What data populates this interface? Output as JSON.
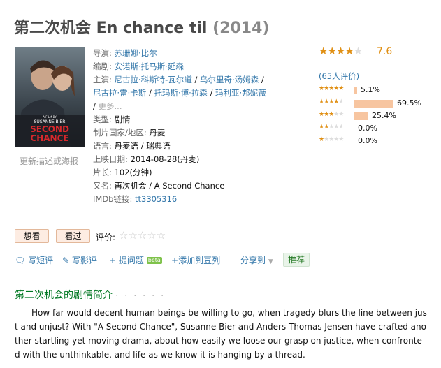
{
  "page": {
    "title_main": "第二次机会 En chance til",
    "title_year": "(2014)"
  },
  "poster": {
    "film_by": "A FILM BY",
    "director_caps": "SUSANNE BIER",
    "title_line1": "SECOND",
    "title_line2": "CHANCE",
    "update_link": "更新描述或海报"
  },
  "info": {
    "director_label": "导演:",
    "director": "苏珊娜·比尔",
    "writer_label": "编剧:",
    "writer": "安诺斯·托马斯·延森",
    "cast_label": "主演:",
    "cast": [
      "尼古拉·科斯特-瓦尔道",
      "乌尔里奇·汤姆森",
      "尼古拉·雷·卡斯",
      "托玛斯·博·拉森",
      "玛利亚·邦妮薇"
    ],
    "cast_more": "更多...",
    "genre_label": "类型:",
    "genre": "剧情",
    "country_label": "制片国家/地区:",
    "country": "丹麦",
    "language_label": "语言:",
    "language": "丹麦语 / 瑞典语",
    "release_label": "上映日期:",
    "release": "2014-08-28(丹麦)",
    "runtime_label": "片长:",
    "runtime": "102(分钟)",
    "aka_label": "又名:",
    "aka": "再次机会 / A Second Chance",
    "imdb_label": "IMDb链接:",
    "imdb": "tt3305316"
  },
  "rating": {
    "score": "7.6",
    "stars_filled": 4,
    "count_text": "(65人评价)",
    "distribution": [
      {
        "stars": 5,
        "fraction": 0.051,
        "label": "5.1%"
      },
      {
        "stars": 4,
        "fraction": 0.695,
        "label": "69.5%"
      },
      {
        "stars": 3,
        "fraction": 0.254,
        "label": "25.4%"
      },
      {
        "stars": 2,
        "fraction": 0.0,
        "label": "0.0%"
      },
      {
        "stars": 1,
        "fraction": 0.0,
        "label": "0.0%"
      }
    ],
    "colors": {
      "star": "#e09015",
      "bar": "#f7c5a0"
    }
  },
  "buttons": {
    "want": "想看",
    "seen": "看过",
    "rate_label": "评价:"
  },
  "actions": {
    "short_review": "写短评",
    "review": "写影评",
    "ask": "提问题",
    "beta": "beta",
    "add_list": "添加到豆列",
    "share": "分享到",
    "recommend": "推荐"
  },
  "summary": {
    "heading": "第二次机会的剧情简介",
    "dots": "· · · · · ·",
    "text": "How far would decent human beings be willing to go, when tragedy blurs the line between just and unjust? With \"A Second Chance\", Susanne Bier and Anders Thomas Jensen have crafted another startling yet moving drama, about how easily we loose our grasp on justice, when confronted with the unthinkable, and life as we know it is hanging by a thread."
  }
}
